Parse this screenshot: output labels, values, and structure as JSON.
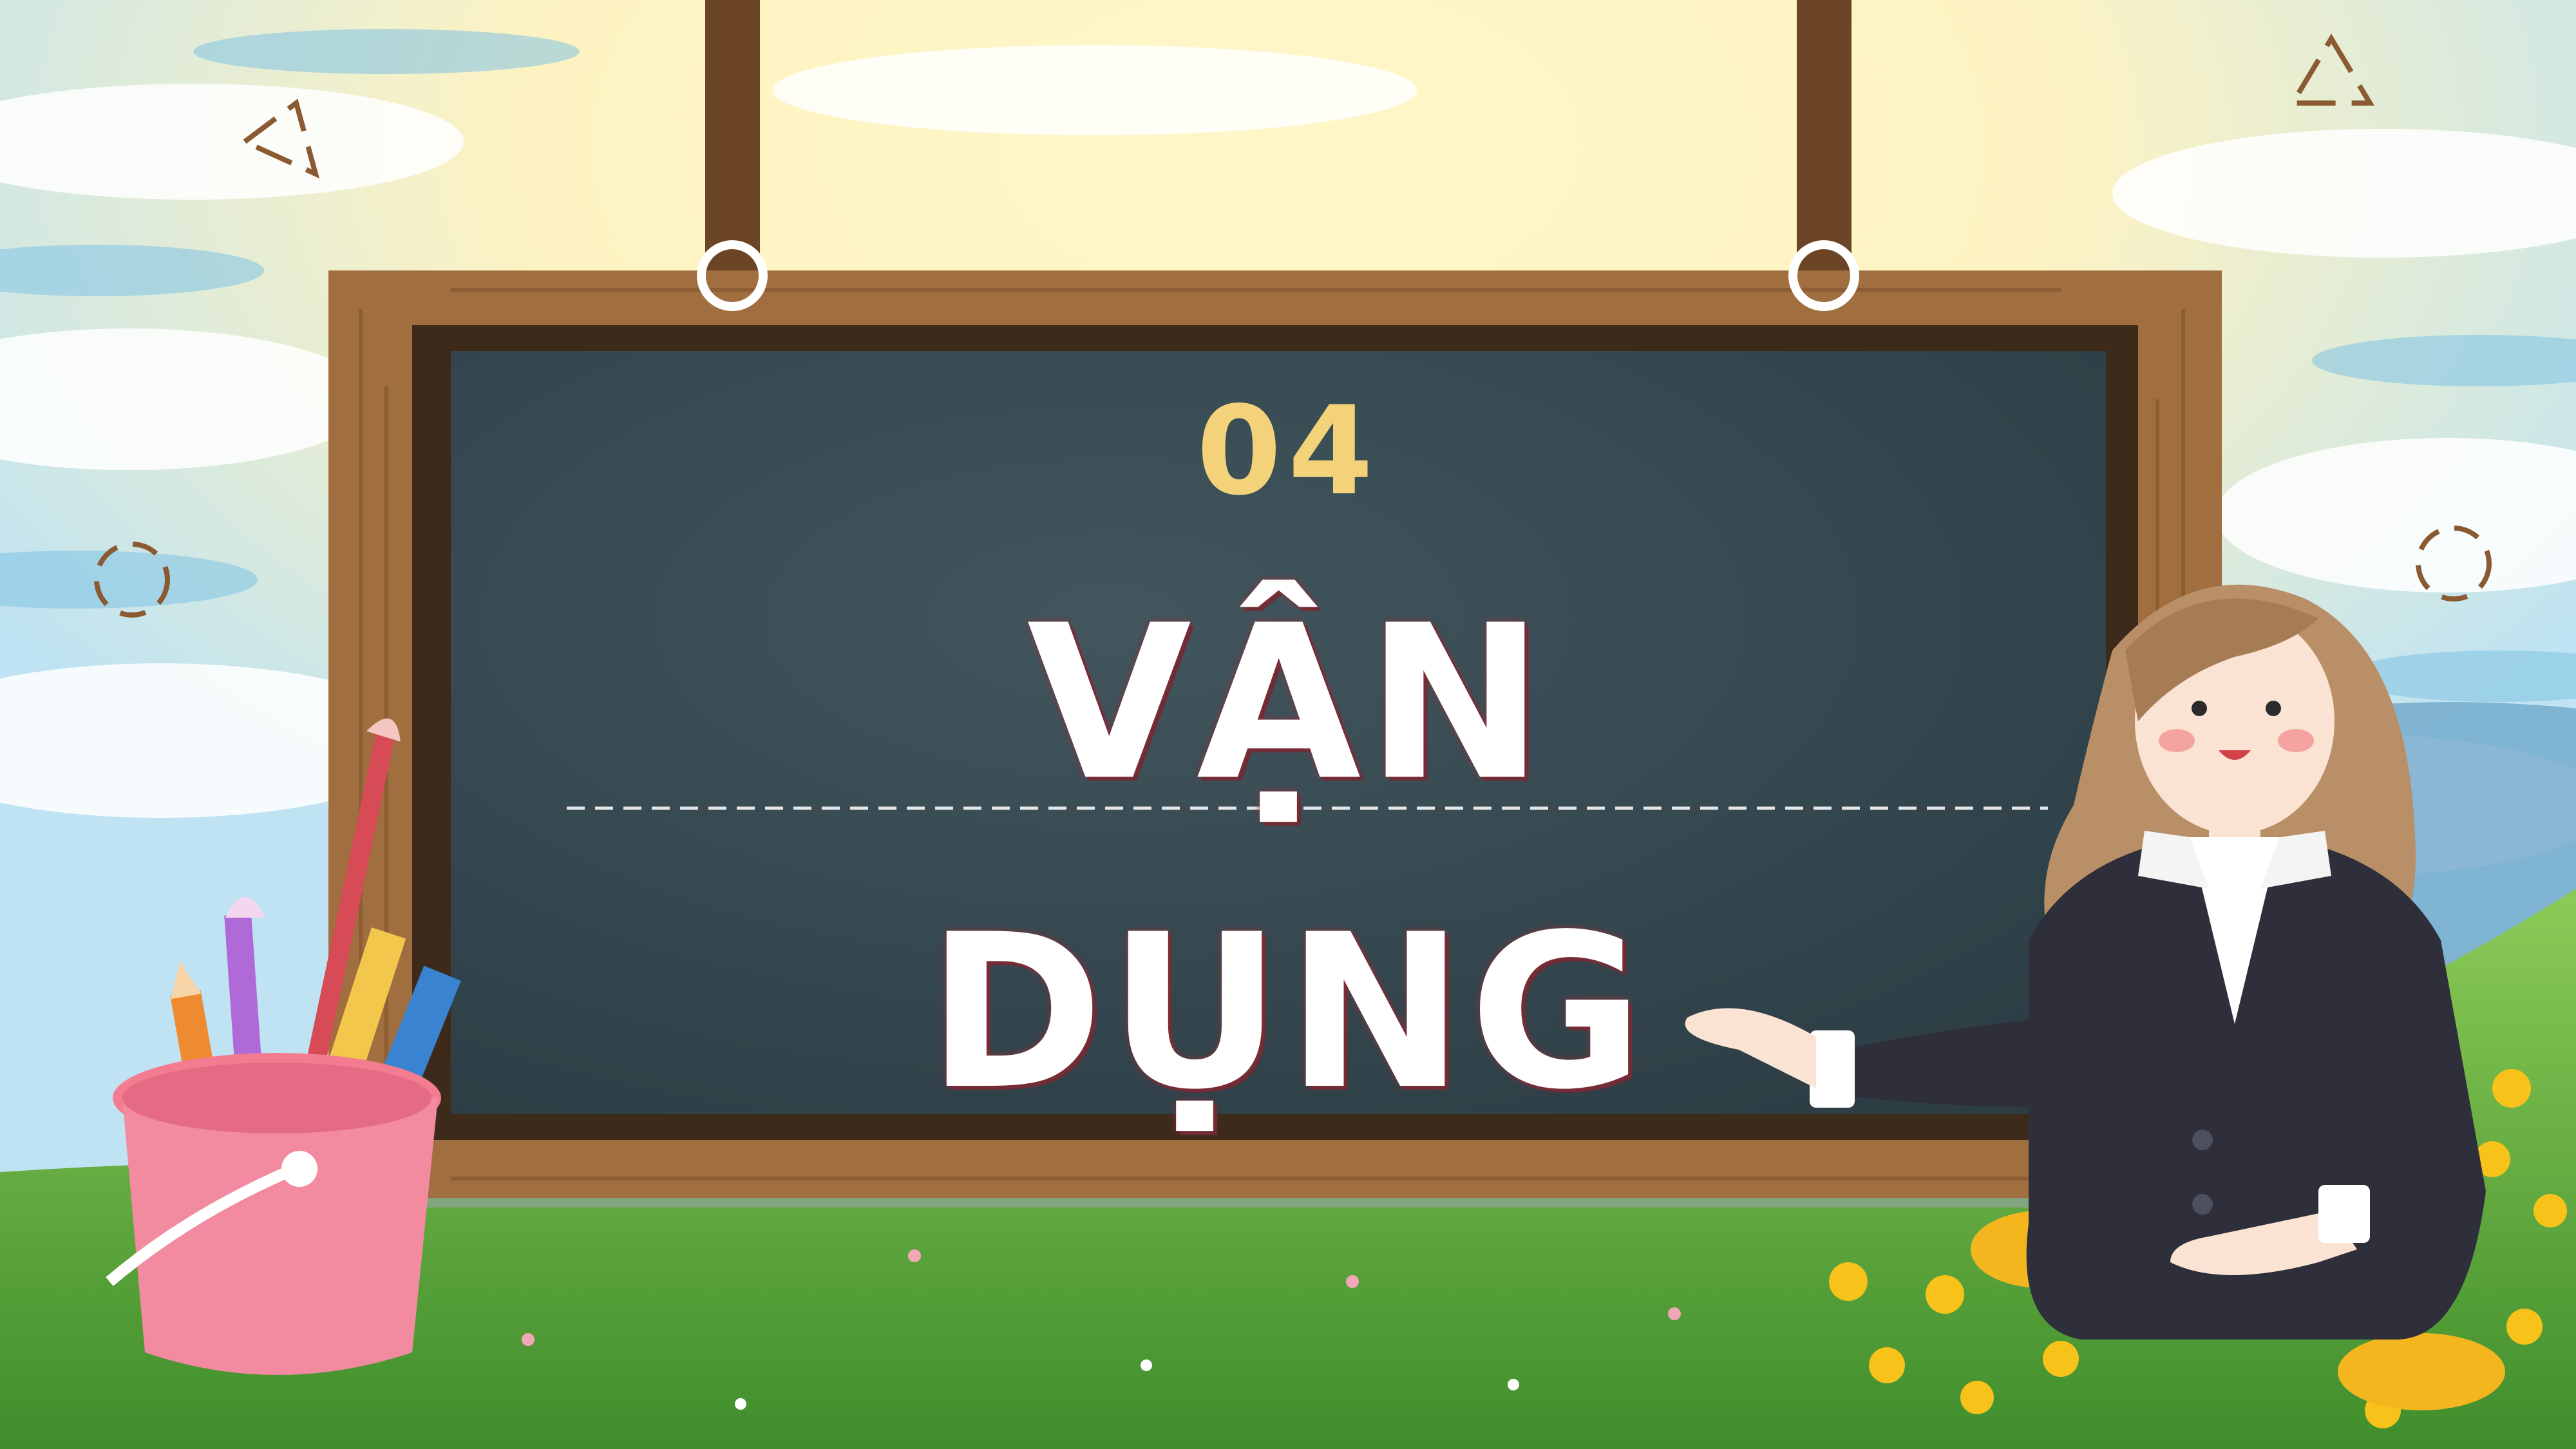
{
  "slide": {
    "section_number": "04",
    "title_line_1": "VẬN",
    "title_line_2": "DỤNG"
  },
  "colors": {
    "sky": "#bfe3f2",
    "sun": "#fff3b0",
    "grass": "#5fae3a",
    "board_frame": "#9b6a3c",
    "chalkboard": "#34484f",
    "number": "#f3d27a",
    "title": "#ffffff",
    "title_outline": "#7a2e38"
  },
  "icons": [
    "triangle-icon",
    "dashed-circle-icon",
    "pencil-cup-icon",
    "teacher-illustration",
    "flower-icon"
  ]
}
